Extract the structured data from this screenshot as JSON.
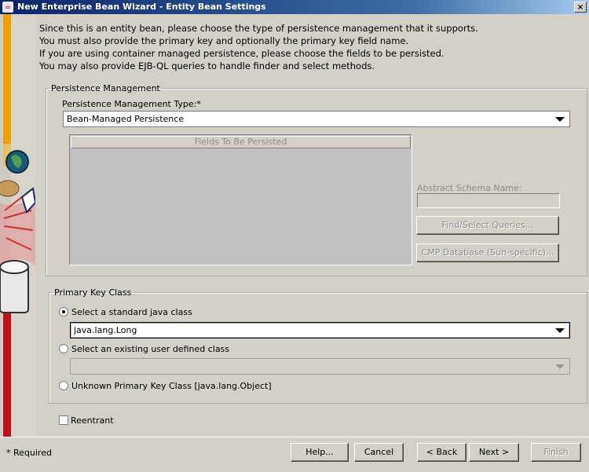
{
  "window": {
    "title": "New Enterprise Bean Wizard - Entity Bean Settings",
    "close_symbol": "×"
  },
  "intro": {
    "lines": [
      "Since this is an entity bean, please choose the type of persistence management that it supports.",
      "You must also provide the primary key and optionally the primary key field name.",
      "If you are using container managed persistence, please choose the fields to be persisted.",
      "You may also provide EJB-QL queries to handle finder and select methods."
    ]
  },
  "persistence": {
    "group_label": "Persistence Management",
    "type_label": "Persistence Management Type:*",
    "type_value": "Bean-Managed Persistence",
    "fields_table_header": "Fields To Be Persisted",
    "schema_label": "Abstract Schema Name:",
    "schema_value": "",
    "queries_button": "Find/Select Queries...",
    "cmp_button": "CMP Database (Sun-specific)..."
  },
  "primary_key": {
    "group_label": "Primary Key Class",
    "standard_label": "Select a standard java class",
    "standard_value": "java.lang.Long",
    "standard_selected": true,
    "user_defined_label": "Select an existing user defined class",
    "user_defined_value": "",
    "unknown_label": "Unknown Primary Key Class [java.lang.Object]"
  },
  "reentrant": {
    "label": "Reentrant",
    "checked": false
  },
  "footer": {
    "required_note": "* Required",
    "help": "Help...",
    "cancel": "Cancel",
    "back": "< Back",
    "next": "Next >",
    "finish": "Finish"
  },
  "icons": {
    "app": "java-cup-icon",
    "close": "close-icon",
    "globe": "globe-icon"
  }
}
